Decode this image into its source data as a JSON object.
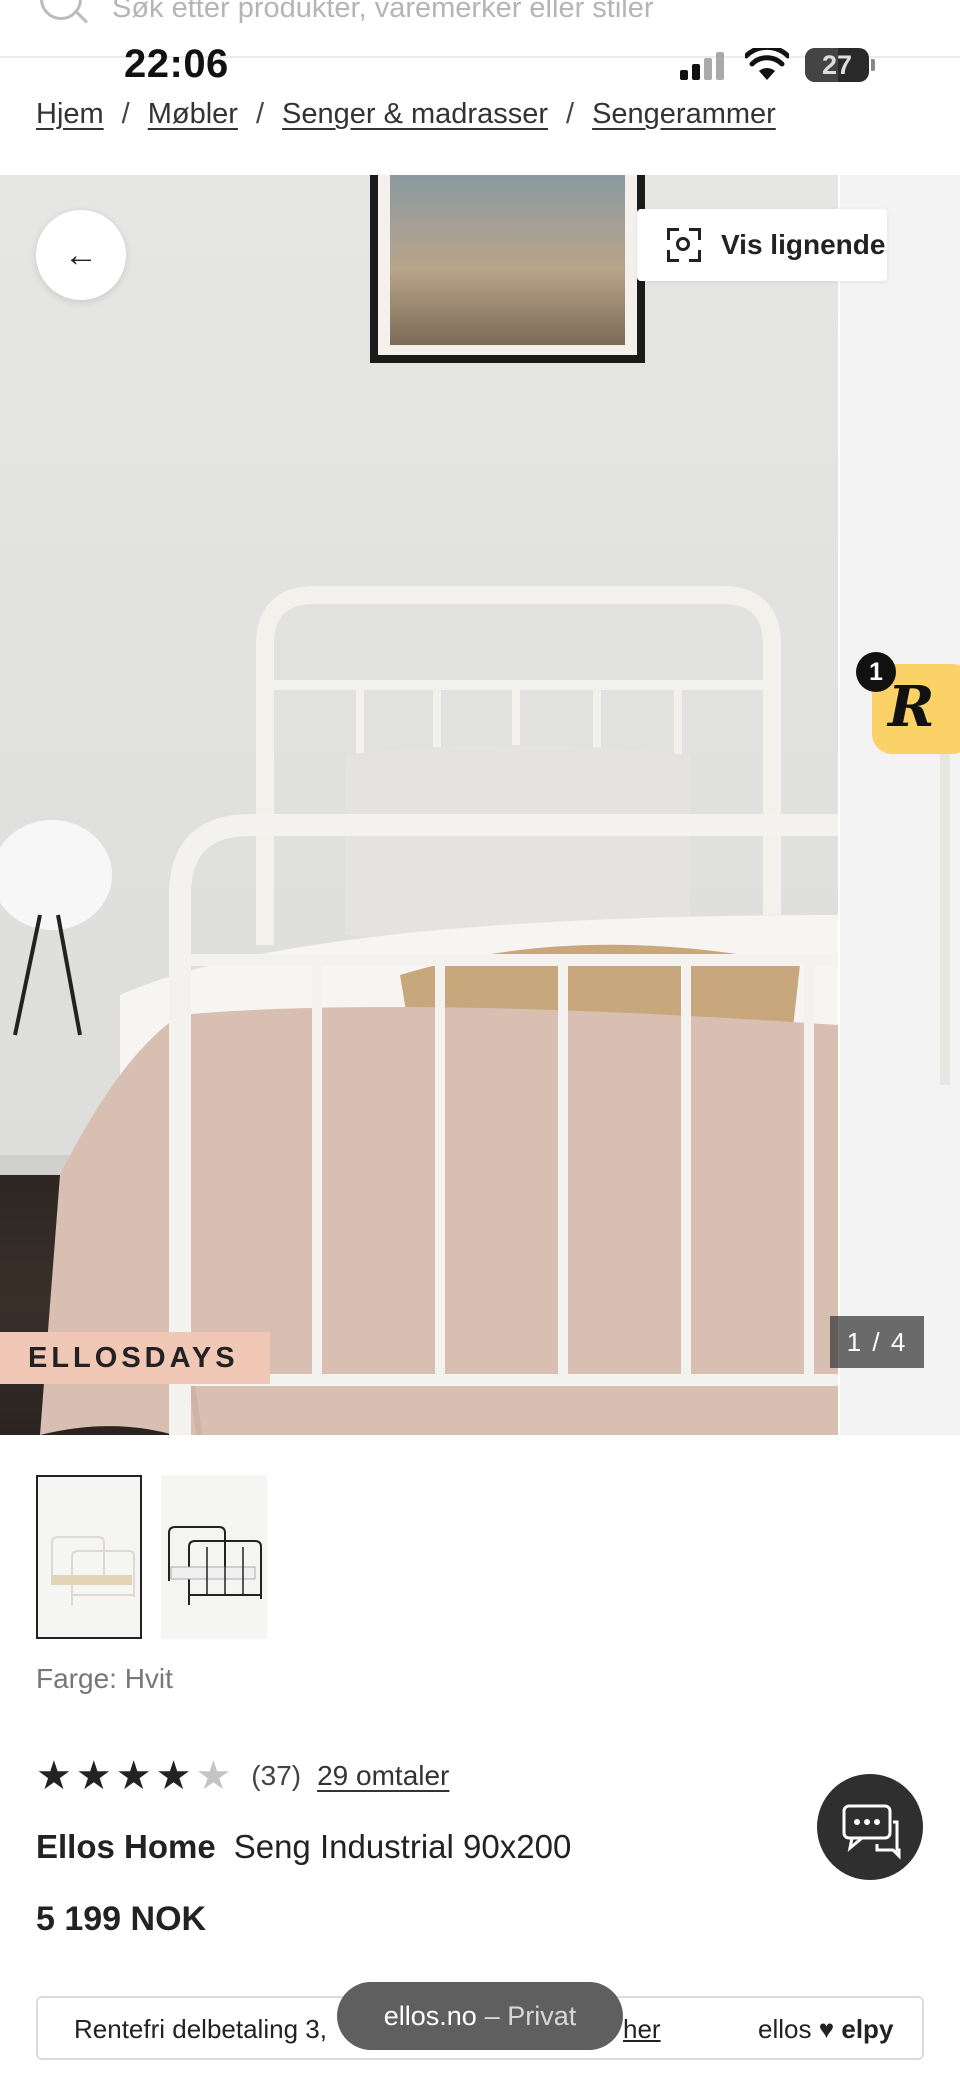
{
  "search": {
    "placeholder": "Søk etter produkter, varemerker eller stiler"
  },
  "status_bar": {
    "time": "22:06",
    "battery": "27"
  },
  "breadcrumb": [
    {
      "label": "Hjem"
    },
    {
      "label": "Møbler"
    },
    {
      "label": "Senger & madrasser"
    },
    {
      "label": "Sengerammer"
    }
  ],
  "breadcrumb_separator": "/",
  "gallery": {
    "similar_label": "Vis lignende",
    "tag": "ELLOSDAYS",
    "counter": "1 / 4",
    "current": 1,
    "total": 4
  },
  "badge": {
    "count": "1",
    "letter": "R"
  },
  "variant": {
    "color_label": "Farge: Hvit"
  },
  "rating": {
    "value": 4,
    "max": 5,
    "count": "(37)",
    "reviews_link": "29 omtaler"
  },
  "product": {
    "brand": "Ellos Home",
    "name": "Seng Industrial 90x200",
    "price": "5 199 NOK"
  },
  "installment": {
    "text": "Rentefri delbetaling 3,",
    "link_text": "her",
    "logo_left": "ellos",
    "logo_right": "elpy"
  },
  "browser": {
    "domain": "ellos.no",
    "mode": "– Privat"
  },
  "colors": {
    "tag_bg": "#f1c7b6",
    "badge_bg": "#fbd267",
    "chat_bg": "#2f2f2f"
  }
}
